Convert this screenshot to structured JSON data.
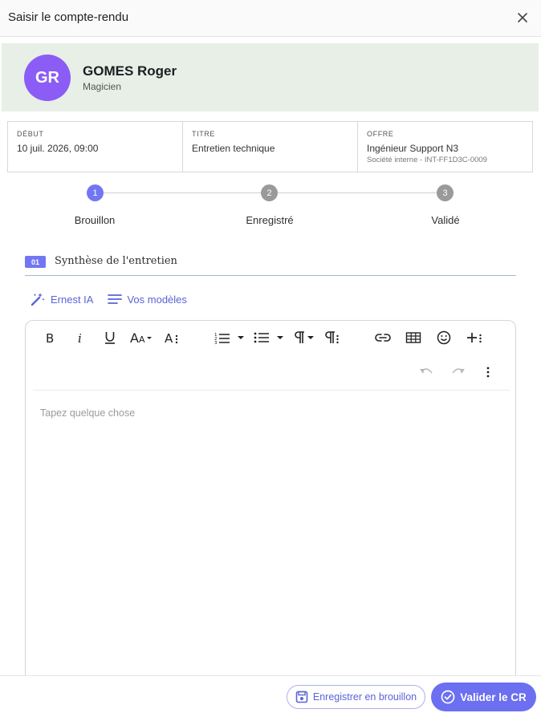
{
  "dialog": {
    "title": "Saisir le compte-rendu"
  },
  "candidate": {
    "initials": "GR",
    "name": "GOMES Roger",
    "role": "Magicien",
    "avatar_color": "#8b5cf6"
  },
  "info": [
    {
      "label": "DÉBUT",
      "value": "10 juil. 2026, 09:00"
    },
    {
      "label": "TITRE",
      "value": "Entretien technique"
    },
    {
      "label": "OFFRE",
      "value": "Ingénieur Support N3",
      "sub": "Société interne - INT-FF1D3C-0009"
    }
  ],
  "stepper": {
    "steps": [
      {
        "number": "1",
        "label": "Brouillon",
        "active": true
      },
      {
        "number": "2",
        "label": "Enregistré",
        "active": false
      },
      {
        "number": "3",
        "label": "Validé",
        "active": false
      }
    ],
    "active_color": "#7376f2",
    "inactive_color": "#9a9a9a"
  },
  "section": {
    "badge": "01",
    "title": "Synthèse de l'entretien"
  },
  "tools": {
    "ai_label": "Ernest IA",
    "templates_label": "Vos modèles"
  },
  "editor": {
    "placeholder": "Tapez quelque chose",
    "toolbar": [
      "bold-icon",
      "italic-icon",
      "underline-icon",
      "font-size-icon",
      "text-style-icon",
      "ordered-list-icon",
      "unordered-list-icon",
      "paragraph-format-icon",
      "paragraph-style-icon",
      "link-icon",
      "table-icon",
      "emoji-icon",
      "insert-more-icon",
      "undo-icon",
      "redo-icon",
      "more-vertical-icon"
    ]
  },
  "footer": {
    "draft_label": "Enregistrer en brouillon",
    "validate_label": "Valider le CR"
  },
  "colors": {
    "accent": "#6b6ff0",
    "candidate_bg": "#e7efe6"
  }
}
